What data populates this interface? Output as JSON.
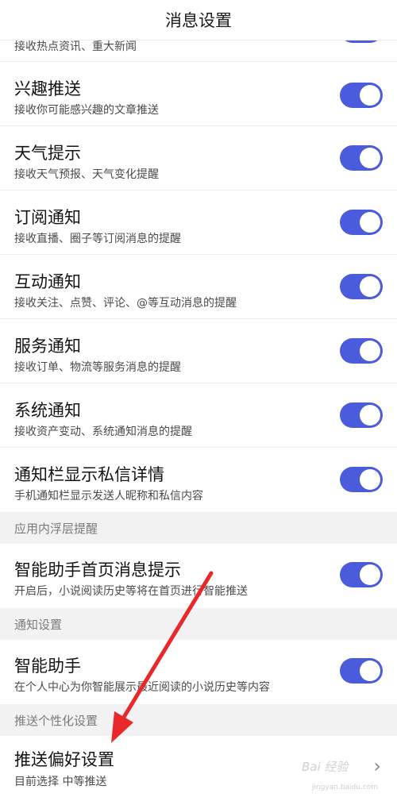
{
  "header": {
    "title": "消息设置"
  },
  "top_partial": {
    "subtitle": "接收热点资讯、重大新闻",
    "enabled": true
  },
  "rows": [
    {
      "title": "兴趣推送",
      "subtitle": "接收你可能感兴趣的文章推送",
      "enabled": true
    },
    {
      "title": "天气提示",
      "subtitle": "接收天气预报、天气变化提醒",
      "enabled": true
    },
    {
      "title": "订阅通知",
      "subtitle": "接收直播、圈子等订阅消息的提醒",
      "enabled": true
    },
    {
      "title": "互动通知",
      "subtitle": "接收关注、点赞、评论、@等互动消息的提醒",
      "enabled": true
    },
    {
      "title": "服务通知",
      "subtitle": "接收订单、物流等服务消息的提醒",
      "enabled": true
    },
    {
      "title": "系统通知",
      "subtitle": "接收资产变动、系统通知消息的提醒",
      "enabled": true
    },
    {
      "title": "通知栏显示私信详情",
      "subtitle": "手机通知栏显示发送人昵称和私信内容",
      "enabled": true
    }
  ],
  "sections": {
    "overlay": "应用内浮层提醒",
    "notify": "通知设置",
    "push_personal": "推送个性化设置"
  },
  "assistant_home": {
    "title": "智能助手首页消息提示",
    "subtitle": "开启后，小说阅读历史等将在首页进行智能推送",
    "enabled": true
  },
  "assistant": {
    "title": "智能助手",
    "subtitle": "在个人中心为你智能展示最近阅读的小说历史等内容",
    "enabled": true
  },
  "push_pref": {
    "title": "推送偏好设置",
    "subtitle": "目前选择 中等推送"
  },
  "watermark": {
    "text": "Bai 经验",
    "sub": "jingyan.baidu.com"
  },
  "colors": {
    "toggle_on": "#4a5bdc",
    "annotation_arrow": "#e8282a",
    "section_bg": "#f2f2f2"
  }
}
